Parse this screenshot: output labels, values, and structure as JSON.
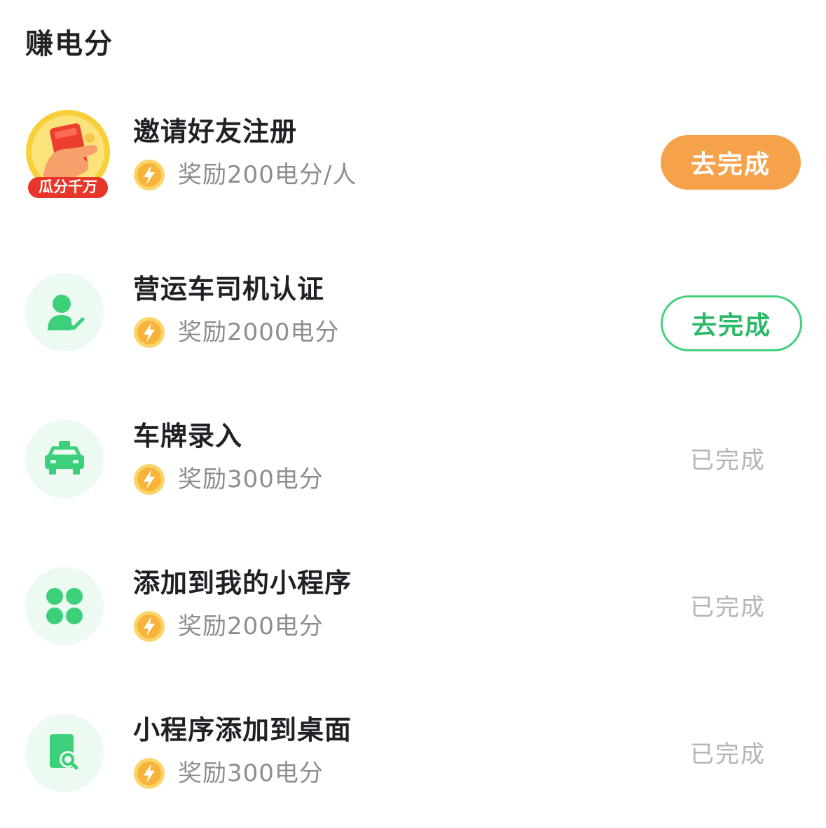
{
  "section": {
    "title": "赚电分"
  },
  "colors": {
    "accent_green": "#41d17e",
    "accent_orange": "#f6a24b",
    "icon_bg": "#ecfaf2",
    "muted_text": "#8b8d94",
    "done_text": "#b3b5ba"
  },
  "tasks": [
    {
      "name": "邀请好友注册",
      "reward": "奖励200电分/人",
      "icon": "red-envelope-hand-icon",
      "badge": "瓜分千万",
      "action": {
        "label": "去完成",
        "style": "filled-orange"
      }
    },
    {
      "name": "营运车司机认证",
      "reward": "奖励2000电分",
      "icon": "person-verified-icon",
      "action": {
        "label": "去完成",
        "style": "outline-green"
      }
    },
    {
      "name": "车牌录入",
      "reward": "奖励300电分",
      "icon": "taxi-car-icon",
      "action": {
        "label": "已完成",
        "style": "done-text"
      }
    },
    {
      "name": "添加到我的小程序",
      "reward": "奖励200电分",
      "icon": "four-leaf-clover-icon",
      "action": {
        "label": "已完成",
        "style": "done-text"
      }
    },
    {
      "name": "小程序添加到桌面",
      "reward": "奖励300电分",
      "icon": "document-search-icon",
      "action": {
        "label": "已完成",
        "style": "done-text"
      }
    }
  ]
}
